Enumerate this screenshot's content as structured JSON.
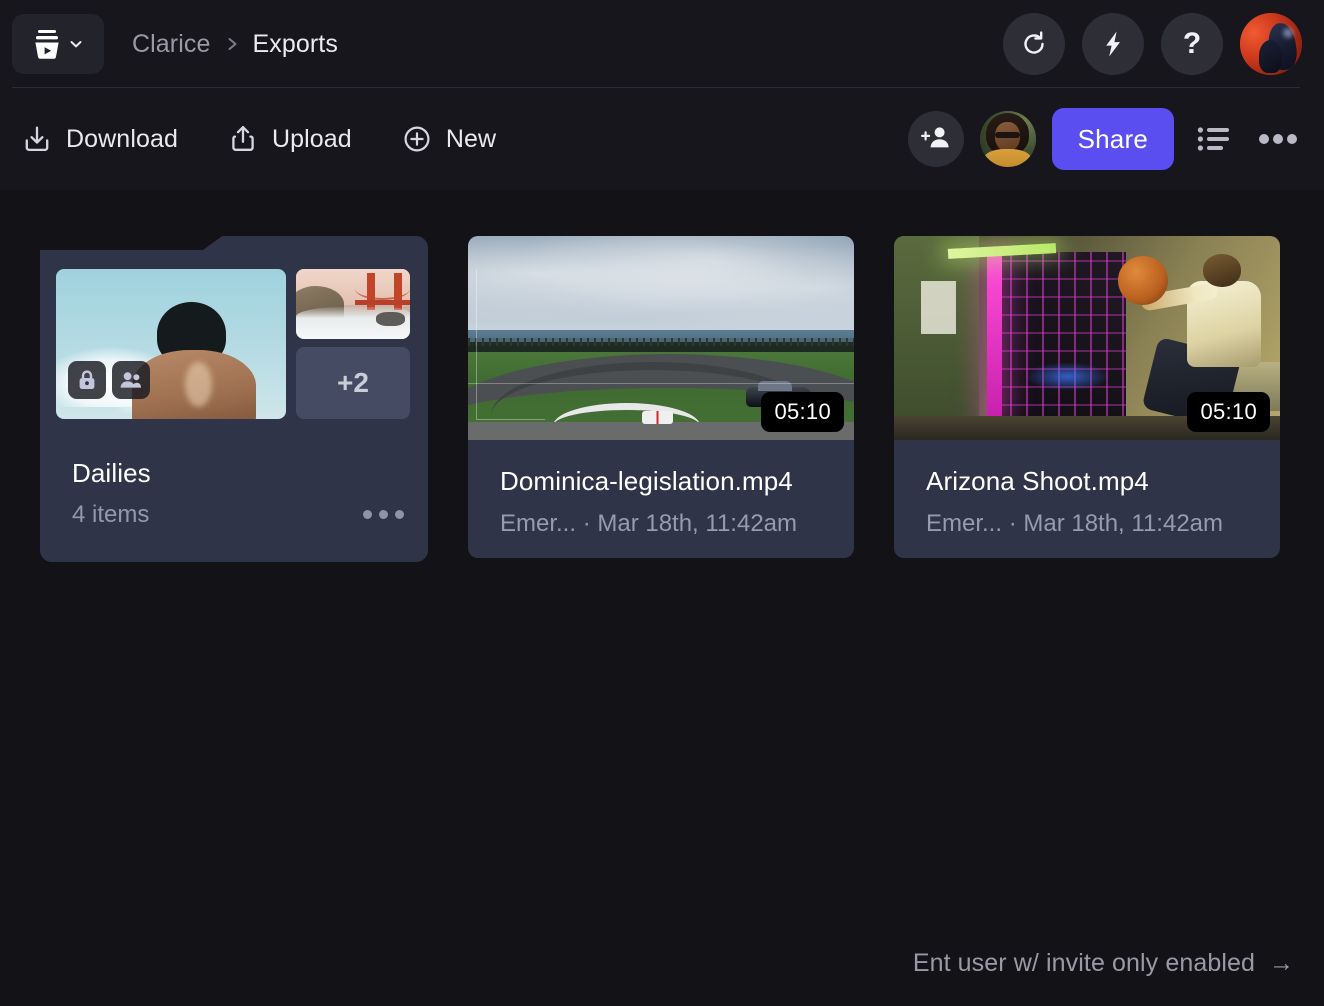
{
  "app": {
    "background_color": "#121217",
    "surface_color": "#16161c",
    "card_color": "#2f3448",
    "accent_color": "#5b4ef0"
  },
  "topbar": {
    "workspace_button": {
      "icon": "frameio-logo-icon",
      "chevron": "chevron-down-icon"
    },
    "breadcrumb": {
      "root": "Clarice",
      "separator": "chevron-right-icon",
      "current": "Exports"
    },
    "actions": [
      {
        "name": "refresh",
        "icon": "refresh-icon"
      },
      {
        "name": "transfers",
        "icon": "lightning-bolt-icon"
      },
      {
        "name": "help",
        "icon": "question-mark-icon",
        "glyph": "?"
      }
    ],
    "account_avatar": {
      "icon": "avatar",
      "label": "account-avatar"
    }
  },
  "toolbar": {
    "download_label": "Download",
    "upload_label": "Upload",
    "new_label": "New",
    "download_icon": "download-icon",
    "upload_icon": "upload-icon",
    "new_icon": "plus-circle-icon",
    "invite_icon": "add-person-icon",
    "collaborator_avatar": "collaborator-avatar",
    "share_label": "Share",
    "list_view_icon": "list-view-icon",
    "more_icon": "more-horizontal-icon"
  },
  "content": {
    "folder": {
      "title": "Dailies",
      "item_count": "4 items",
      "more_icon": "more-horizontal-icon",
      "badges": [
        {
          "name": "lock-badge",
          "icon": "lock-icon"
        },
        {
          "name": "shared-badge",
          "icon": "people-icon"
        }
      ],
      "extra_thumbs_label": "+2",
      "thumbnails": [
        {
          "name": "folder-thumb-primary",
          "alt": "person-against-sky"
        },
        {
          "name": "folder-thumb-secondary",
          "alt": "golden-gate-bridge"
        }
      ]
    },
    "files": [
      {
        "name": "Dominica-legislation.mp4",
        "meta": "Emer... · Mar 18th, 11:42am",
        "duration": "05:10",
        "thumb_alt": "race-track"
      },
      {
        "name": "Arizona Shoot.mp4",
        "meta": "Emer... · Mar 18th, 11:42am",
        "duration": "05:10",
        "thumb_alt": "neon-studio-basketball"
      }
    ]
  },
  "footer": {
    "note": "Ent user w/ invite only enabled",
    "arrow": "→"
  }
}
